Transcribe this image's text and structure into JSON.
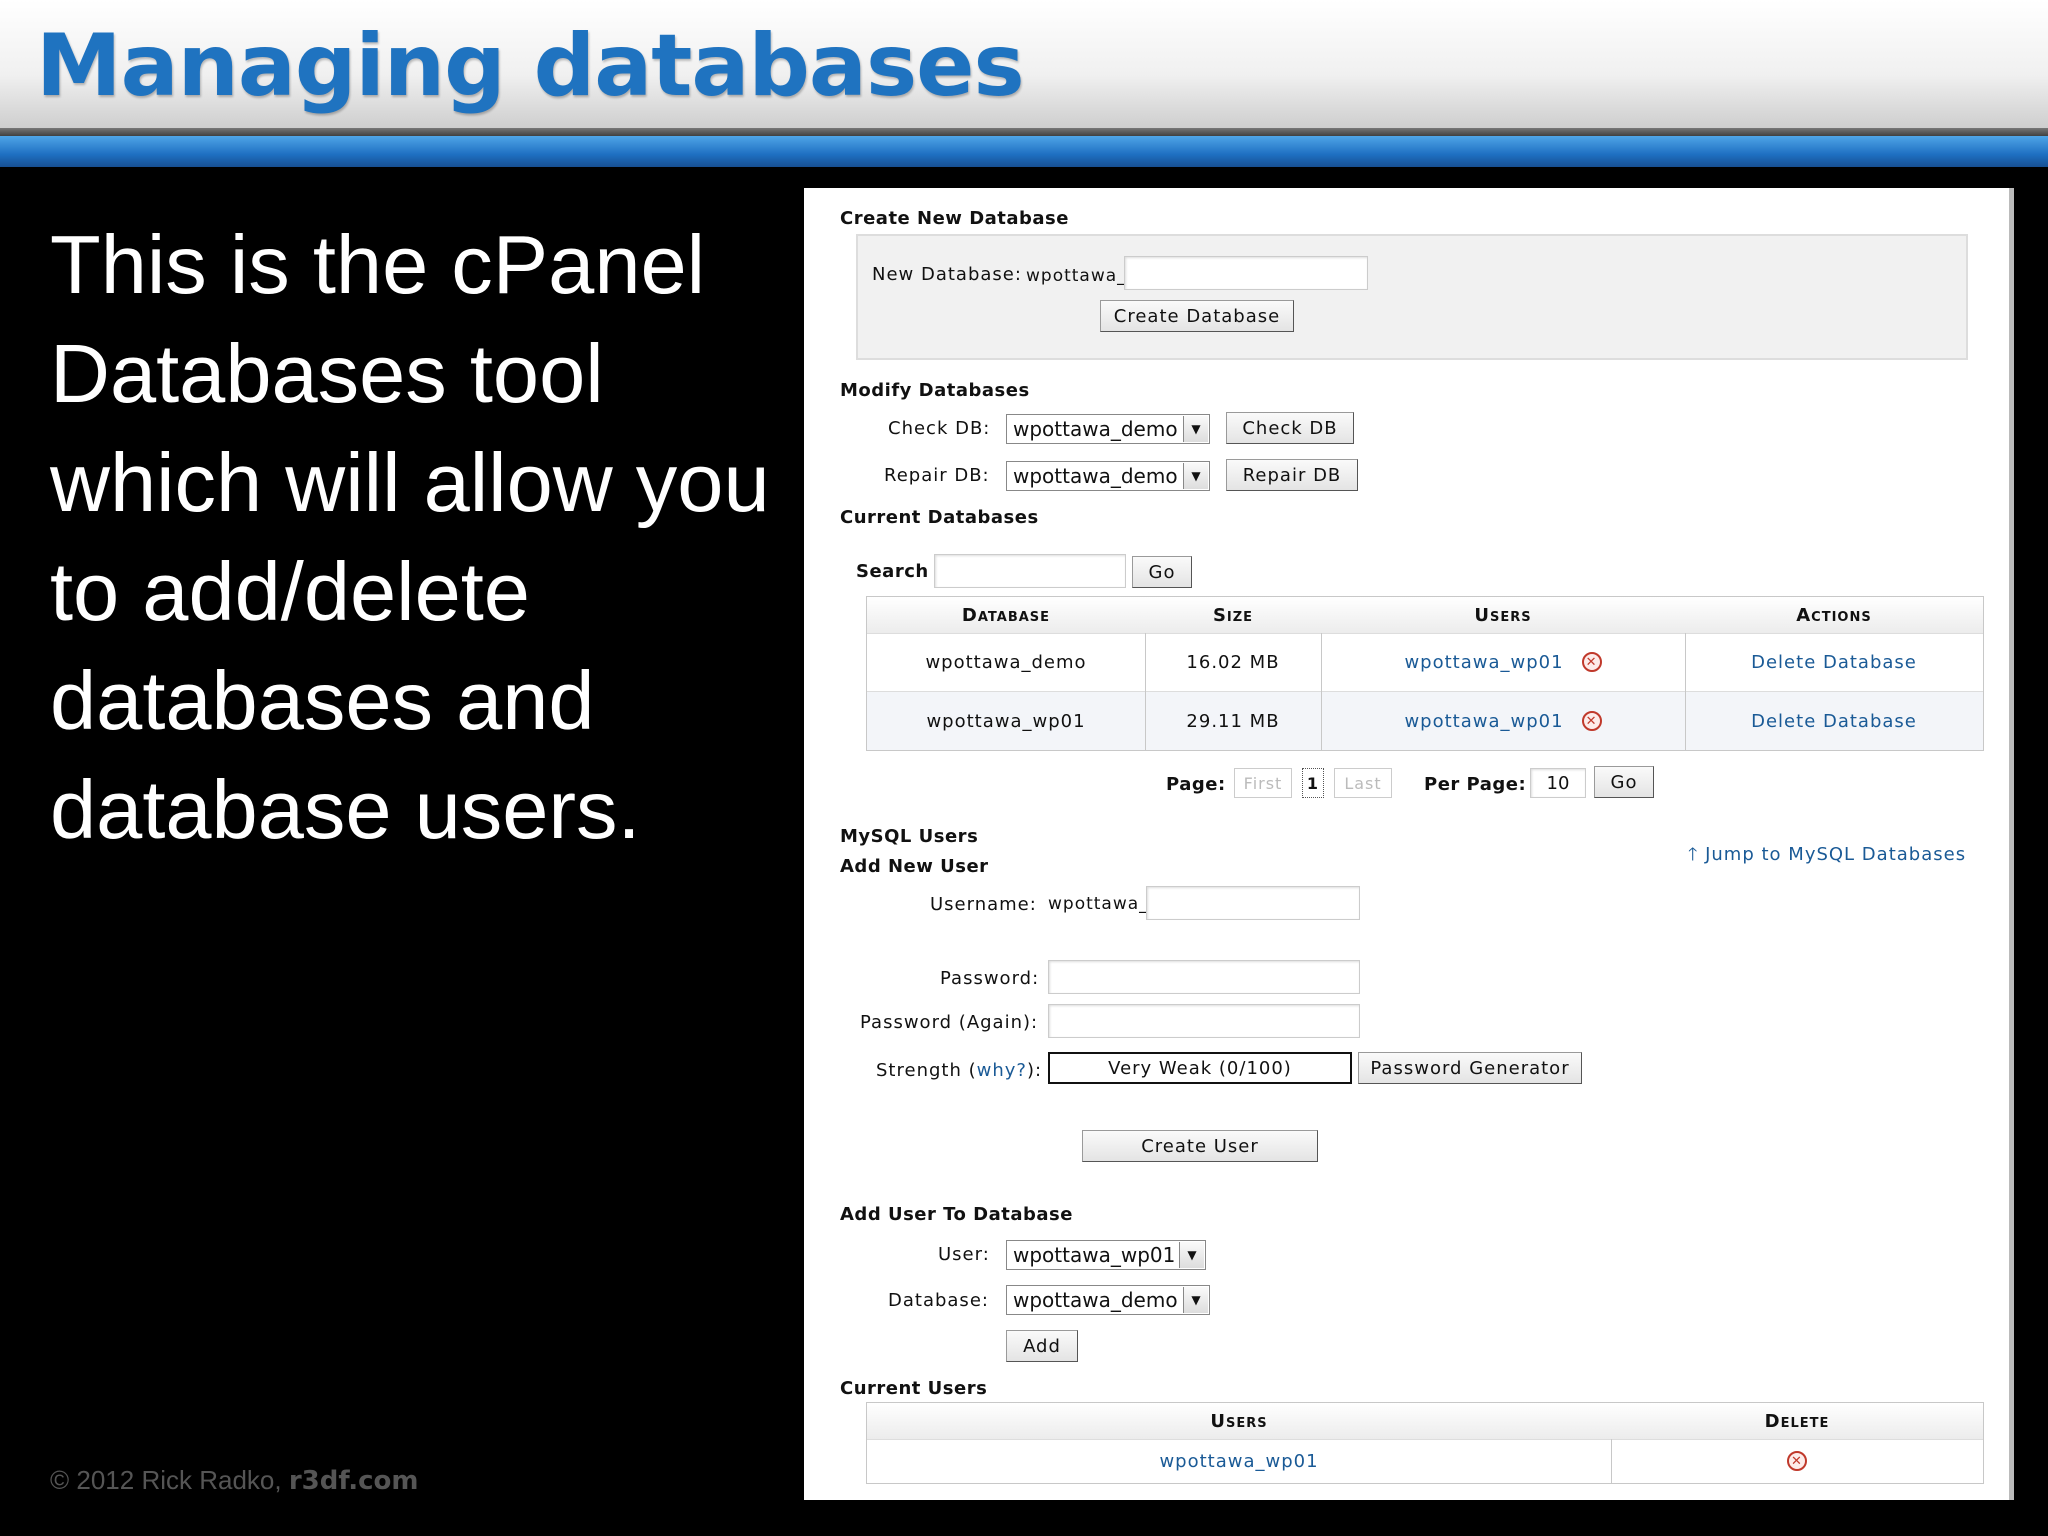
{
  "slide": {
    "title": "Managing databases",
    "body": "This is the cPanel Databases tool which will allow you to add/delete databases and database users.",
    "footer_prefix": "© 2012  Rick Radko, ",
    "footer_site": "r3df.com"
  },
  "create_db": {
    "heading": "Create New Database",
    "label": "New Database:",
    "prefix": "wpottawa_",
    "button": "Create Database"
  },
  "modify_db": {
    "heading": "Modify Databases",
    "check_label": "Check DB:",
    "check_value": "wpottawa_demo",
    "check_button": "Check DB",
    "repair_label": "Repair DB:",
    "repair_value": "wpottawa_demo",
    "repair_button": "Repair DB"
  },
  "current_dbs": {
    "heading": "Current Databases",
    "search_label": "Search",
    "search_button": "Go",
    "columns": [
      "Database",
      "Size",
      "Users",
      "Actions"
    ],
    "rows": [
      {
        "database": "wpottawa_demo",
        "size": "16.02 MB",
        "user": "wpottawa_wp01",
        "action": "Delete Database"
      },
      {
        "database": "wpottawa_wp01",
        "size": "29.11 MB",
        "user": "wpottawa_wp01",
        "action": "Delete Database"
      }
    ]
  },
  "pagination": {
    "page_label": "Page:",
    "first": "First",
    "current": "1",
    "last": "Last",
    "per_page_label": "Per Page:",
    "per_page_value": "10",
    "go": "Go"
  },
  "mysql_users": {
    "heading": "MySQL Users",
    "subheading": "Add New User",
    "jump_link": "Jump to MySQL Databases",
    "username_label": "Username:",
    "username_prefix": "wpottawa_",
    "password_label": "Password:",
    "password_again_label": "Password (Again):",
    "strength_label_pre": "Strength (",
    "strength_why": "why?",
    "strength_label_post": "):",
    "strength_value": "Very Weak (0/100)",
    "generator_button": "Password Generator",
    "create_button": "Create User"
  },
  "add_user_db": {
    "heading": "Add User To Database",
    "user_label": "User:",
    "user_value": "wpottawa_wp01",
    "database_label": "Database:",
    "database_value": "wpottawa_demo",
    "add_button": "Add"
  },
  "current_users": {
    "heading": "Current Users",
    "columns": [
      "Users",
      "Delete"
    ],
    "rows": [
      {
        "user": "wpottawa_wp01"
      }
    ]
  },
  "colors": {
    "title_blue": "#1f73c0",
    "link_blue": "#1a5a96",
    "delete_red": "#c0392b"
  },
  "icons": {
    "delete": "x-circle-icon",
    "jump": "arrow-up-icon",
    "dropdown": "triangle-down-icon"
  }
}
